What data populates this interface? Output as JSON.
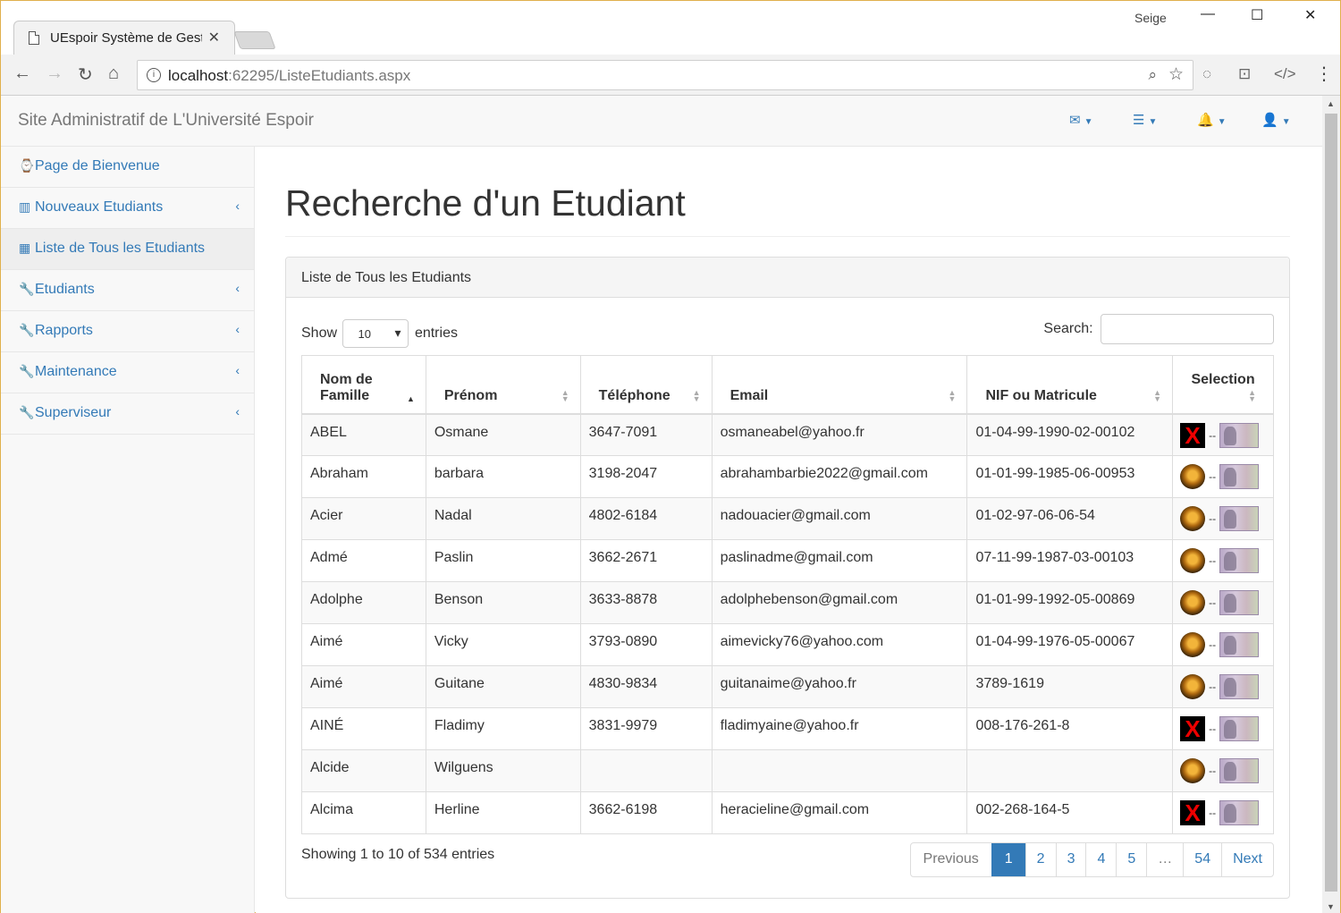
{
  "browser": {
    "tab_title": "UEspoir Système de Gesti",
    "tab_close": "✕",
    "profile": "Seige",
    "window_controls": {
      "minimize": "—",
      "maximize": "☐",
      "close": "✕"
    },
    "nav": {
      "back": "←",
      "forward": "→",
      "reload": "↻",
      "home": "⌂"
    },
    "url_host": "localhost",
    "url_rest": ":62295/ListeEtudiants.aspx",
    "menu": "⋮"
  },
  "app": {
    "brand": "Site Administratif de L'Université Espoir",
    "nav_icons": [
      {
        "icon": "envelope-icon",
        "glyph": "✉"
      },
      {
        "icon": "tasks-icon",
        "glyph": "☰"
      },
      {
        "icon": "bell-icon",
        "glyph": "🔔"
      },
      {
        "icon": "user-icon",
        "glyph": "👤"
      }
    ]
  },
  "sidebar": {
    "items": [
      {
        "label": "Page de Bienvenue",
        "icon": "dashboard-icon",
        "glyph": "⌚",
        "chevron": ""
      },
      {
        "label": "Nouveaux Etudiants",
        "icon": "bar-chart-icon",
        "glyph": "▥",
        "chevron": "‹"
      },
      {
        "label": "Liste de Tous les Etudiants",
        "icon": "table-icon",
        "glyph": "▦",
        "chevron": ""
      },
      {
        "label": "Etudiants",
        "icon": "wrench-icon",
        "glyph": "🔧",
        "chevron": "‹"
      },
      {
        "label": "Rapports",
        "icon": "wrench-icon",
        "glyph": "🔧",
        "chevron": "‹"
      },
      {
        "label": "Maintenance",
        "icon": "wrench-icon",
        "glyph": "🔧",
        "chevron": "‹"
      },
      {
        "label": "Superviseur",
        "icon": "wrench-icon",
        "glyph": "🔧",
        "chevron": "‹"
      }
    ]
  },
  "main": {
    "title": "Recherche d'un Etudiant",
    "panel_title": "Liste de Tous les Etudiants",
    "show_label": "Show",
    "page_length": "10",
    "entries_label": "entries",
    "search_label": "Search:",
    "search_value": "",
    "columns": [
      "Nom de Famille",
      "Prénom",
      "Téléphone",
      "Email",
      "NIF ou Matricule",
      "Selection"
    ],
    "rows": [
      {
        "nom": "ABEL",
        "prenom": "Osmane",
        "tel": "3647-7091",
        "email": "osmaneabel@yahoo.fr",
        "nif": "01-04-99-1990-02-00102",
        "photo": "none",
        "sep": "--"
      },
      {
        "nom": "Abraham",
        "prenom": "barbara",
        "tel": "3198-2047",
        "email": "abrahambarbie2022@gmail.com",
        "nif": "01-01-99-1985-06-00953",
        "photo": "lion",
        "sep": "--"
      },
      {
        "nom": "Acier",
        "prenom": "Nadal",
        "tel": "4802-6184",
        "email": "nadouacier@gmail.com",
        "nif": "01-02-97-06-06-54",
        "photo": "lion",
        "sep": "--"
      },
      {
        "nom": "Admé",
        "prenom": "Paslin",
        "tel": "3662-2671",
        "email": "paslinadme@gmail.com",
        "nif": "07-11-99-1987-03-00103",
        "photo": "lion",
        "sep": "--"
      },
      {
        "nom": "Adolphe",
        "prenom": "Benson",
        "tel": "3633-8878",
        "email": "adolphebenson@gmail.com",
        "nif": "01-01-99-1992-05-00869",
        "photo": "lion",
        "sep": "--"
      },
      {
        "nom": "Aimé",
        "prenom": "Vicky",
        "tel": "3793-0890",
        "email": "aimevicky76@yahoo.com",
        "nif": "01-04-99-1976-05-00067",
        "photo": "lion",
        "sep": "--"
      },
      {
        "nom": "Aimé",
        "prenom": "Guitane",
        "tel": "4830-9834",
        "email": "guitanaime@yahoo.fr",
        "nif": "3789-1619",
        "photo": "lion",
        "sep": "--"
      },
      {
        "nom": "AINÉ",
        "prenom": "Fladimy",
        "tel": "3831-9979",
        "email": "fladimyaine@yahoo.fr",
        "nif": "008-176-261-8",
        "photo": "none",
        "sep": "--"
      },
      {
        "nom": "Alcide",
        "prenom": "Wilguens",
        "tel": "",
        "email": "",
        "nif": "",
        "photo": "lion",
        "sep": "--"
      },
      {
        "nom": "Alcima",
        "prenom": "Herline",
        "tel": "3662-6198",
        "email": "heracieline@gmail.com",
        "nif": "002-268-164-5",
        "photo": "none",
        "sep": "--"
      }
    ],
    "info": "Showing 1 to 10 of 534 entries",
    "pagination": [
      "Previous",
      "1",
      "2",
      "3",
      "4",
      "5",
      "…",
      "54",
      "Next"
    ],
    "current_page": "1",
    "colors": {
      "link": "#337ab7",
      "active_page": "#337ab7"
    }
  }
}
